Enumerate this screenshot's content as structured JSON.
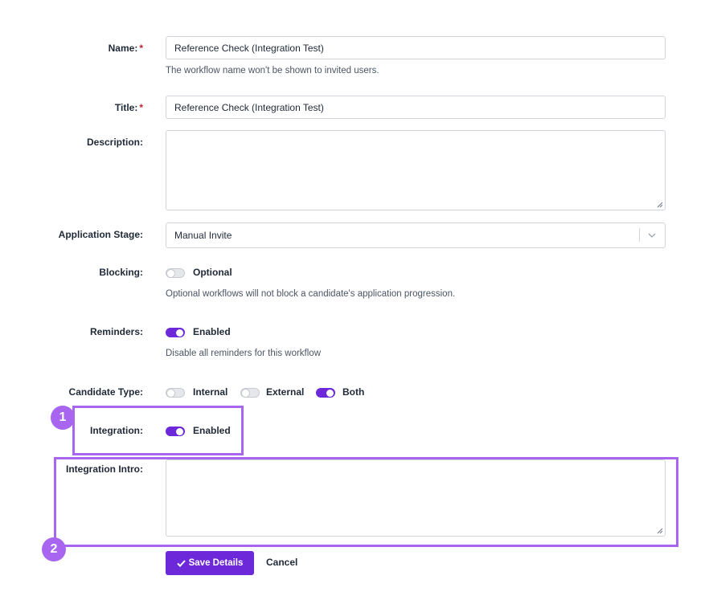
{
  "fields": {
    "name": {
      "label": "Name:",
      "required_mark": "*",
      "value": "Reference Check (Integration Test)",
      "help": "The workflow name won't be shown to invited users."
    },
    "title": {
      "label": "Title:",
      "required_mark": "*",
      "value": "Reference Check (Integration Test)"
    },
    "description": {
      "label": "Description:",
      "value": ""
    },
    "application_stage": {
      "label": "Application Stage:",
      "selected": "Manual Invite",
      "icon": "chevron-down-icon"
    },
    "blocking": {
      "label": "Blocking:",
      "state": "off",
      "state_label": "Optional",
      "help": "Optional workflows will not block a candidate's application progression."
    },
    "reminders": {
      "label": "Reminders:",
      "state": "on",
      "state_label": "Enabled",
      "help": "Disable all reminders for this workflow"
    },
    "candidate_type": {
      "label": "Candidate Type:",
      "options": [
        {
          "label": "Internal",
          "state": "off"
        },
        {
          "label": "External",
          "state": "off"
        },
        {
          "label": "Both",
          "state": "on"
        }
      ]
    },
    "integration": {
      "label": "Integration:",
      "state": "on",
      "state_label": "Enabled"
    },
    "integration_intro": {
      "label": "Integration Intro:",
      "value": ""
    }
  },
  "actions": {
    "save_label": "Save Details",
    "save_icon": "checkmark-icon",
    "cancel_label": "Cancel"
  },
  "annotations": {
    "badge_1": "1",
    "badge_2": "2",
    "highlight_color": "#a866f0"
  },
  "colors": {
    "accent": "#6d28d9",
    "required": "#c0262d",
    "toggle_off": "#e5e7eb"
  }
}
